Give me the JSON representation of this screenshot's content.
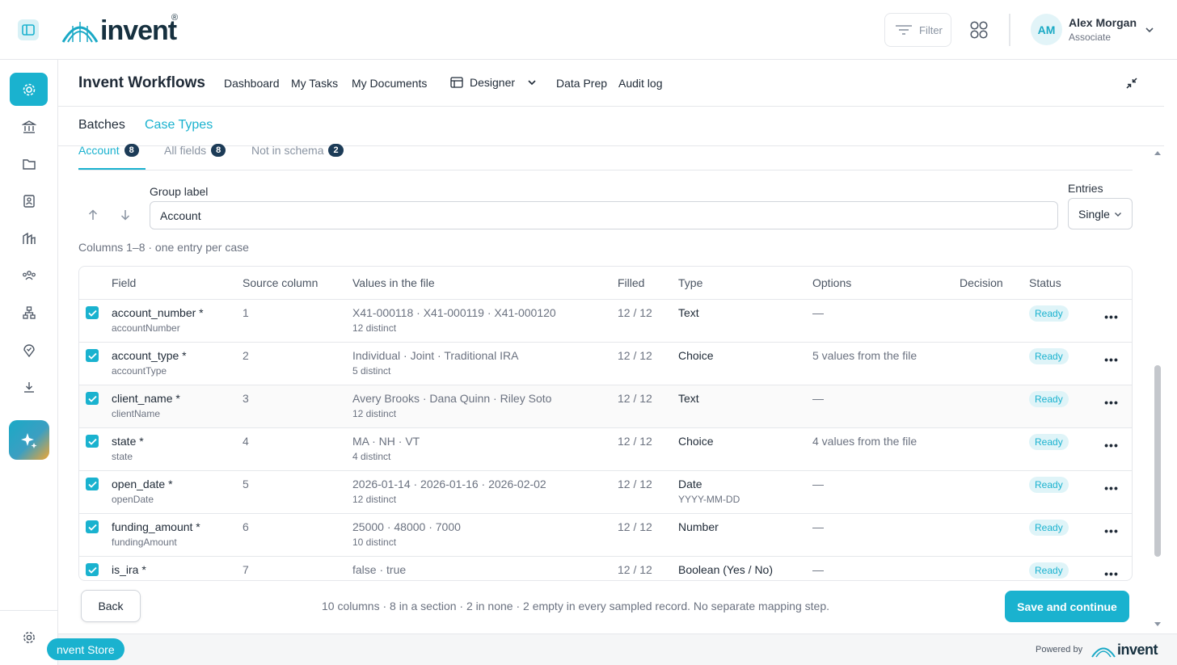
{
  "brand": {
    "logo_text": "invent",
    "logo_reg": "®"
  },
  "topbar": {
    "filter_label": "Filter",
    "user": {
      "initials": "AM",
      "name": "Alex Morgan",
      "role": "Associate"
    }
  },
  "header": {
    "app_title": "Invent Workflows",
    "nav": [
      "Dashboard",
      "My Tasks",
      "My Documents",
      "Designer",
      "Data Prep",
      "Audit log"
    ],
    "subtabs": [
      "Batches",
      "Case Types"
    ],
    "active_subtab": "Case Types"
  },
  "section_tabs": [
    {
      "label": "Account",
      "count": "8",
      "active": true
    },
    {
      "label": "All fields",
      "count": "8",
      "active": false
    },
    {
      "label": "Not in schema",
      "count": "2",
      "active": false
    }
  ],
  "group": {
    "label": "Group label",
    "value": "Account",
    "entries_label": "Entries",
    "entries_value": "Single",
    "columns_note": "Columns 1–8 · one entry per case"
  },
  "table": {
    "headers": [
      "Field",
      "Source column",
      "Values in the file",
      "Filled",
      "Type",
      "Options",
      "Decision",
      "Status"
    ],
    "rows": [
      {
        "name": "account_number *",
        "key": "accountNumber",
        "source": "1",
        "values": "X41-000118 · X41-000119 · X41-000120",
        "distinct": "12 distinct",
        "filled": "12 / 12",
        "type": "Text",
        "format": "",
        "options": "—",
        "status": "Ready"
      },
      {
        "name": "account_type *",
        "key": "accountType",
        "source": "2",
        "values": "Individual · Joint · Traditional IRA",
        "distinct": "5 distinct",
        "filled": "12 / 12",
        "type": "Choice",
        "format": "",
        "options": "5 values from the file",
        "status": "Ready"
      },
      {
        "name": "client_name *",
        "key": "clientName",
        "source": "3",
        "values": "Avery Brooks · Dana Quinn · Riley Soto",
        "distinct": "12 distinct",
        "filled": "12 / 12",
        "type": "Text",
        "format": "",
        "options": "—",
        "status": "Ready"
      },
      {
        "name": "state *",
        "key": "state",
        "source": "4",
        "values": "MA · NH · VT",
        "distinct": "4 distinct",
        "filled": "12 / 12",
        "type": "Choice",
        "format": "",
        "options": "4 values from the file",
        "status": "Ready"
      },
      {
        "name": "open_date *",
        "key": "openDate",
        "source": "5",
        "values": "2026-01-14 · 2026-01-16 · 2026-02-02",
        "distinct": "12 distinct",
        "filled": "12 / 12",
        "type": "Date",
        "format": "YYYY-MM-DD",
        "options": "—",
        "status": "Ready"
      },
      {
        "name": "funding_amount *",
        "key": "fundingAmount",
        "source": "6",
        "values": "25000 · 48000 · 7000",
        "distinct": "10 distinct",
        "filled": "12 / 12",
        "type": "Number",
        "format": "",
        "options": "—",
        "status": "Ready"
      },
      {
        "name": "is_ira *",
        "key": "",
        "source": "7",
        "values": "false · true",
        "distinct": "",
        "filled": "12 / 12",
        "type": "Boolean (Yes / No)",
        "format": "",
        "options": "—",
        "status": "Ready"
      }
    ]
  },
  "footer": {
    "back_label": "Back",
    "note": "10 columns · 8 in a section · 2 in none · 2 empty in every sampled record. No separate mapping step.",
    "save_label": "Save and continue"
  },
  "bottom": {
    "store_label": "nvent Store",
    "powered_by": "Powered by",
    "logo_text": "invent"
  },
  "colors": {
    "accent": "#1ab2cf",
    "badge": "#1c3b57",
    "status_bg": "#dff4f8"
  }
}
